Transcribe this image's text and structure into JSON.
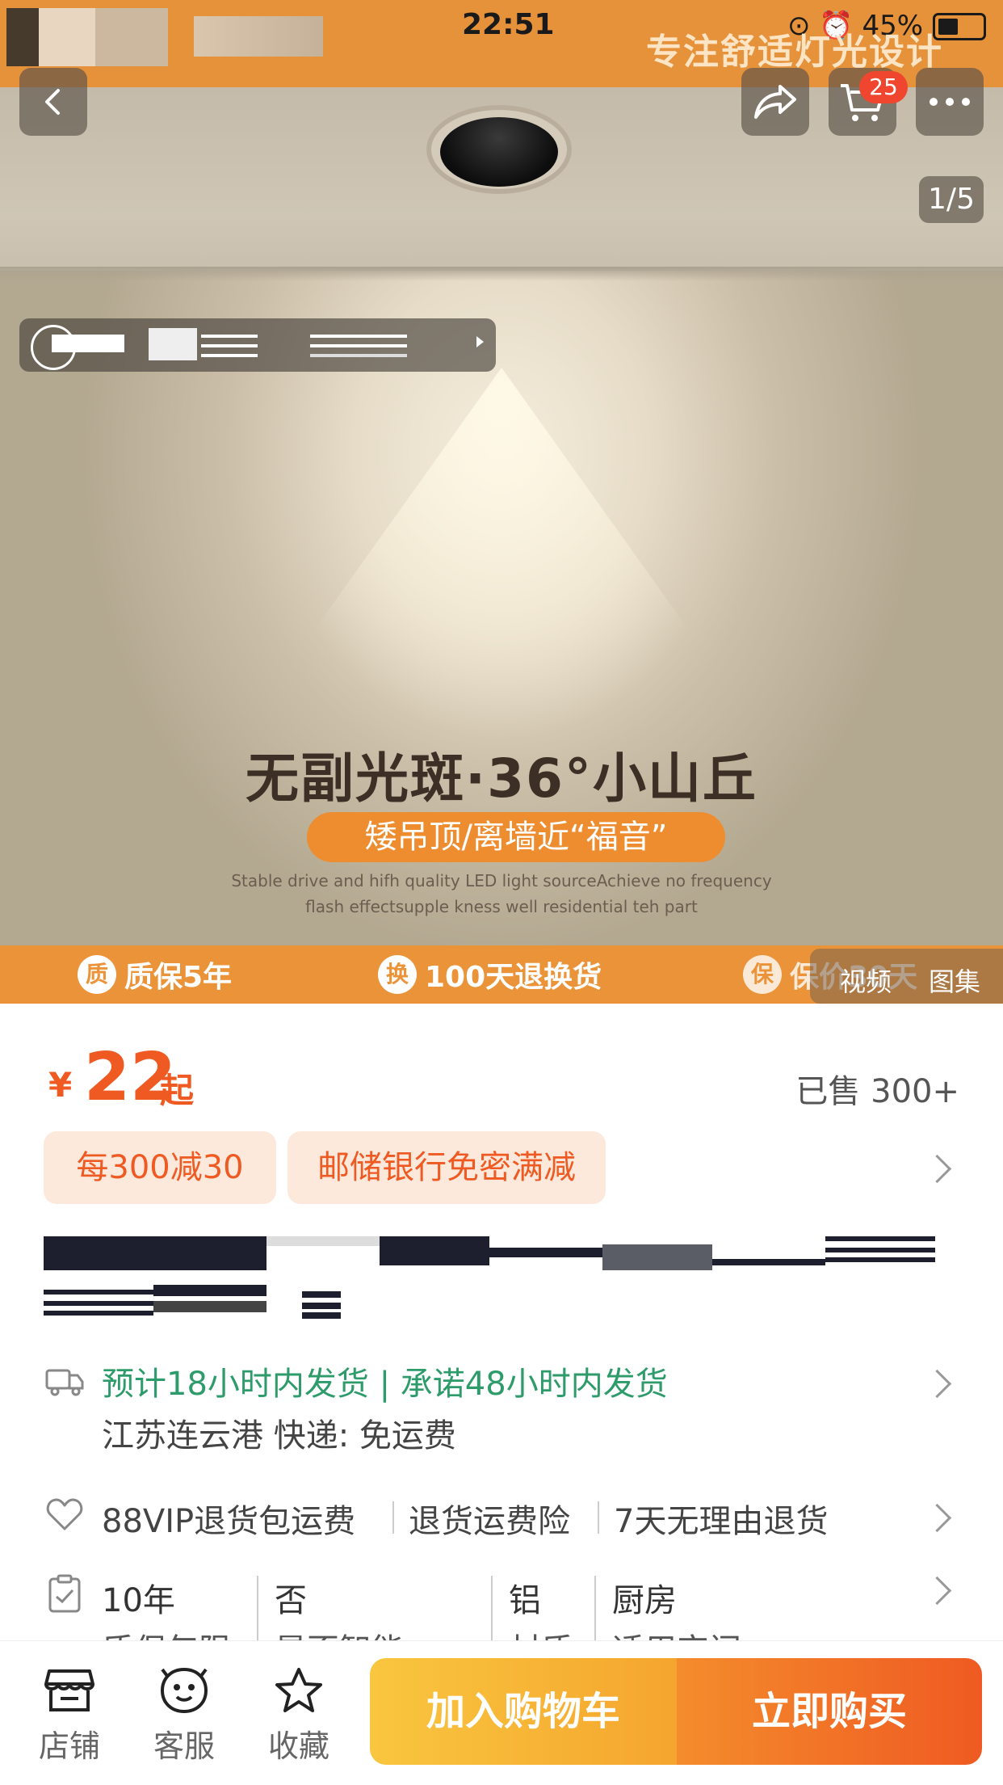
{
  "status_bar": {
    "time": "22:51",
    "battery": "45%"
  },
  "banner": {
    "slogan": "专注舒适灯光设计"
  },
  "nav": {
    "cart_count": "25",
    "page_indicator": "1/5"
  },
  "hero": {
    "headline": "无副光斑·36°小山丘",
    "subline": "矮吊顶/离墙近“福音”",
    "fine_print_1": "Stable drive and hifh quality LED light sourceAchieve no frequency",
    "fine_print_2": "flash effectsupple kness well residential teh part"
  },
  "promo_bar": [
    {
      "seal": "质",
      "text": "质保5年"
    },
    {
      "seal": "换",
      "text": "100天退换货"
    },
    {
      "seal": "保",
      "text": "保价30天"
    }
  ],
  "media_tabs": {
    "video": "视频",
    "gallery": "图集"
  },
  "price": {
    "symbol": "¥",
    "amount": "22",
    "suffix": "起",
    "sold": "已售 300+"
  },
  "coupons": [
    "每300减30",
    "邮储银行免密满减"
  ],
  "shipping": {
    "line1": "预计18小时内发货 | 承诺48小时内发货",
    "line2": "江苏连云港  快递: 免运费"
  },
  "services": [
    "88VIP退货包运费",
    "退货运费险",
    "7天无理由退货"
  ],
  "specs": [
    {
      "value": "10年",
      "key": "质保年限"
    },
    {
      "value": "否",
      "key": "是否智能"
    },
    {
      "value": "铝",
      "key": "材质"
    },
    {
      "value": "厨房",
      "key": "适用空间"
    }
  ],
  "bottom_nav": {
    "shop": "店铺",
    "service": "客服",
    "favorite": "收藏",
    "add_to_cart": "加入购物车",
    "buy_now": "立即购买"
  },
  "colors": {
    "accent": "#ef5a22",
    "banner": "#e6923a",
    "green": "#2d9b6a"
  }
}
